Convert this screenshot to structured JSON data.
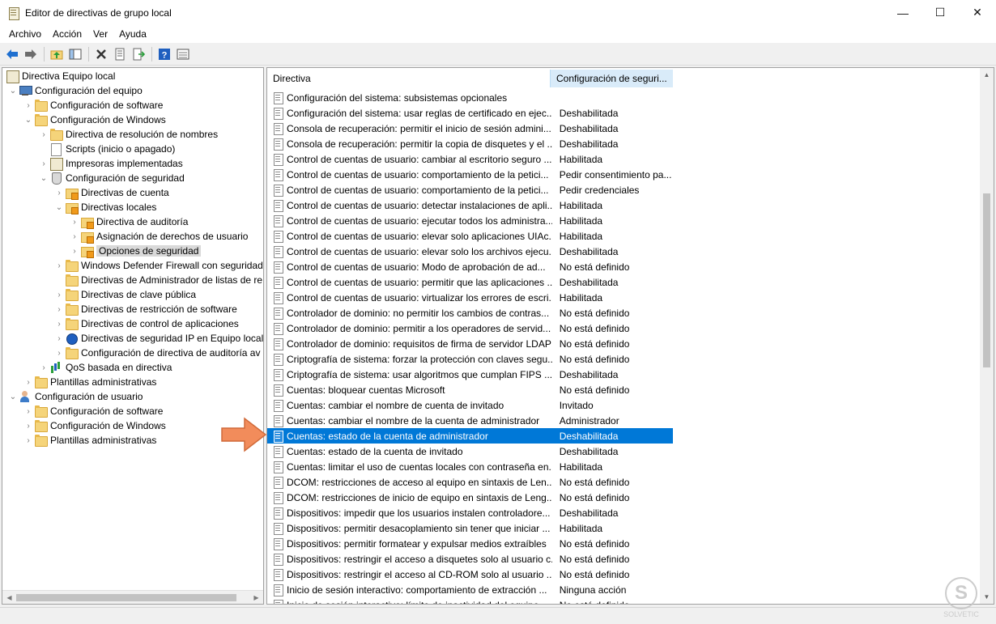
{
  "window": {
    "title": "Editor de directivas de grupo local",
    "minimize": "—",
    "maximize": "☐",
    "close": "✕"
  },
  "menu": [
    "Archivo",
    "Acción",
    "Ver",
    "Ayuda"
  ],
  "tree": {
    "root": "Directiva Equipo local",
    "nodes": [
      {
        "label": "Configuración del equipo",
        "level": 0,
        "chev": "⌄",
        "icon": "computer"
      },
      {
        "label": "Configuración de software",
        "level": 1,
        "chev": "›",
        "icon": "folder"
      },
      {
        "label": "Configuración de Windows",
        "level": 1,
        "chev": "⌄",
        "icon": "folder"
      },
      {
        "label": "Directiva de resolución de nombres",
        "level": 2,
        "chev": "›",
        "icon": "folder"
      },
      {
        "label": "Scripts (inicio o apagado)",
        "level": 2,
        "chev": "",
        "icon": "doc"
      },
      {
        "label": "Impresoras implementadas",
        "level": 2,
        "chev": "›",
        "icon": "book"
      },
      {
        "label": "Configuración de seguridad",
        "level": 2,
        "chev": "⌄",
        "icon": "shield"
      },
      {
        "label": "Directivas de cuenta",
        "level": 3,
        "chev": "›",
        "icon": "lockfolder"
      },
      {
        "label": "Directivas locales",
        "level": 3,
        "chev": "⌄",
        "icon": "lockfolder"
      },
      {
        "label": "Directiva de auditoría",
        "level": 4,
        "chev": "›",
        "icon": "lockfolder"
      },
      {
        "label": "Asignación de derechos de usuario",
        "level": 4,
        "chev": "›",
        "icon": "lockfolder"
      },
      {
        "label": "Opciones de seguridad",
        "level": 4,
        "chev": "›",
        "icon": "lockfolder",
        "selected": true
      },
      {
        "label": "Windows Defender Firewall con seguridad",
        "level": 3,
        "chev": "›",
        "icon": "folder"
      },
      {
        "label": "Directivas de Administrador de listas de re",
        "level": 3,
        "chev": "",
        "icon": "folder"
      },
      {
        "label": "Directivas de clave pública",
        "level": 3,
        "chev": "›",
        "icon": "folder"
      },
      {
        "label": "Directivas de restricción de software",
        "level": 3,
        "chev": "›",
        "icon": "folder"
      },
      {
        "label": "Directivas de control de aplicaciones",
        "level": 3,
        "chev": "›",
        "icon": "folder"
      },
      {
        "label": "Directivas de seguridad IP en Equipo local",
        "level": 3,
        "chev": "›",
        "icon": "globe"
      },
      {
        "label": "Configuración de directiva de auditoría av",
        "level": 3,
        "chev": "›",
        "icon": "folder"
      },
      {
        "label": "QoS basada en directiva",
        "level": 2,
        "chev": "›",
        "icon": "chart"
      },
      {
        "label": "Plantillas administrativas",
        "level": 1,
        "chev": "›",
        "icon": "folder"
      },
      {
        "label": "Configuración de usuario",
        "level": 0,
        "chev": "⌄",
        "icon": "users"
      },
      {
        "label": "Configuración de software",
        "level": 1,
        "chev": "›",
        "icon": "folder"
      },
      {
        "label": "Configuración de Windows",
        "level": 1,
        "chev": "›",
        "icon": "folder"
      },
      {
        "label": "Plantillas administrativas",
        "level": 1,
        "chev": "›",
        "icon": "folder"
      }
    ]
  },
  "list": {
    "col_policy": "Directiva",
    "col_setting": "Configuración de seguri...",
    "rows": [
      {
        "name": "Configuración del sistema: subsistemas opcionales",
        "value": ""
      },
      {
        "name": "Configuración del sistema: usar reglas de certificado en ejec...",
        "value": "Deshabilitada"
      },
      {
        "name": "Consola de recuperación: permitir el inicio de sesión admini...",
        "value": "Deshabilitada"
      },
      {
        "name": "Consola de recuperación: permitir la copia de disquetes y el ...",
        "value": "Deshabilitada"
      },
      {
        "name": "Control de cuentas de usuario: cambiar al escritorio seguro ...",
        "value": "Habilitada"
      },
      {
        "name": "Control de cuentas de usuario: comportamiento de la petici...",
        "value": "Pedir consentimiento pa..."
      },
      {
        "name": "Control de cuentas de usuario: comportamiento de la petici...",
        "value": "Pedir credenciales"
      },
      {
        "name": "Control de cuentas de usuario: detectar instalaciones de apli...",
        "value": "Habilitada"
      },
      {
        "name": "Control de cuentas de usuario: ejecutar todos los administra...",
        "value": "Habilitada"
      },
      {
        "name": "Control de cuentas de usuario: elevar solo aplicaciones UIAc...",
        "value": "Habilitada"
      },
      {
        "name": "Control de cuentas de usuario: elevar solo los archivos ejecu...",
        "value": "Deshabilitada"
      },
      {
        "name": "Control de cuentas de usuario: Modo de aprobación de ad...",
        "value": "No está definido"
      },
      {
        "name": "Control de cuentas de usuario: permitir que las aplicaciones ...",
        "value": "Deshabilitada"
      },
      {
        "name": "Control de cuentas de usuario: virtualizar los errores de escri...",
        "value": "Habilitada"
      },
      {
        "name": "Controlador de dominio: no permitir los cambios de contras...",
        "value": "No está definido"
      },
      {
        "name": "Controlador de dominio: permitir a los operadores de servid...",
        "value": "No está definido"
      },
      {
        "name": "Controlador de dominio: requisitos de firma de servidor LDAP",
        "value": "No está definido"
      },
      {
        "name": "Criptografía de sistema: forzar la protección con claves segu...",
        "value": "No está definido"
      },
      {
        "name": "Criptografía de sistema: usar algoritmos que cumplan FIPS ...",
        "value": "Deshabilitada"
      },
      {
        "name": "Cuentas: bloquear cuentas Microsoft",
        "value": "No está definido"
      },
      {
        "name": "Cuentas: cambiar el nombre de cuenta de invitado",
        "value": "Invitado"
      },
      {
        "name": "Cuentas: cambiar el nombre de la cuenta de administrador",
        "value": "Administrador"
      },
      {
        "name": "Cuentas: estado de la cuenta de administrador",
        "value": "Deshabilitada",
        "selected": true
      },
      {
        "name": "Cuentas: estado de la cuenta de invitado",
        "value": "Deshabilitada"
      },
      {
        "name": "Cuentas: limitar el uso de cuentas locales con contraseña en...",
        "value": "Habilitada"
      },
      {
        "name": "DCOM: restricciones de acceso al equipo en sintaxis de Len...",
        "value": "No está definido"
      },
      {
        "name": "DCOM: restricciones de inicio de equipo en sintaxis de Leng...",
        "value": "No está definido"
      },
      {
        "name": "Dispositivos: impedir que los usuarios instalen controladore...",
        "value": "Deshabilitada"
      },
      {
        "name": "Dispositivos: permitir desacoplamiento sin tener que iniciar ...",
        "value": "Habilitada"
      },
      {
        "name": "Dispositivos: permitir formatear y expulsar medios extraíbles",
        "value": "No está definido"
      },
      {
        "name": "Dispositivos: restringir el acceso a disquetes solo al usuario c...",
        "value": "No está definido"
      },
      {
        "name": "Dispositivos: restringir el acceso al CD-ROM solo al usuario ...",
        "value": "No está definido"
      },
      {
        "name": "Inicio de sesión interactivo: comportamiento de extracción ...",
        "value": "Ninguna acción"
      },
      {
        "name": "Inicio de sesión interactivo: límite de inactividad del equipo",
        "value": "No está definido"
      }
    ]
  },
  "watermark": {
    "glyph": "S",
    "text": "SOLVETIC"
  },
  "colors": {
    "selection": "#0078d7",
    "header_highlight": "#d9ebf9",
    "arrow": "#f28c5b"
  }
}
